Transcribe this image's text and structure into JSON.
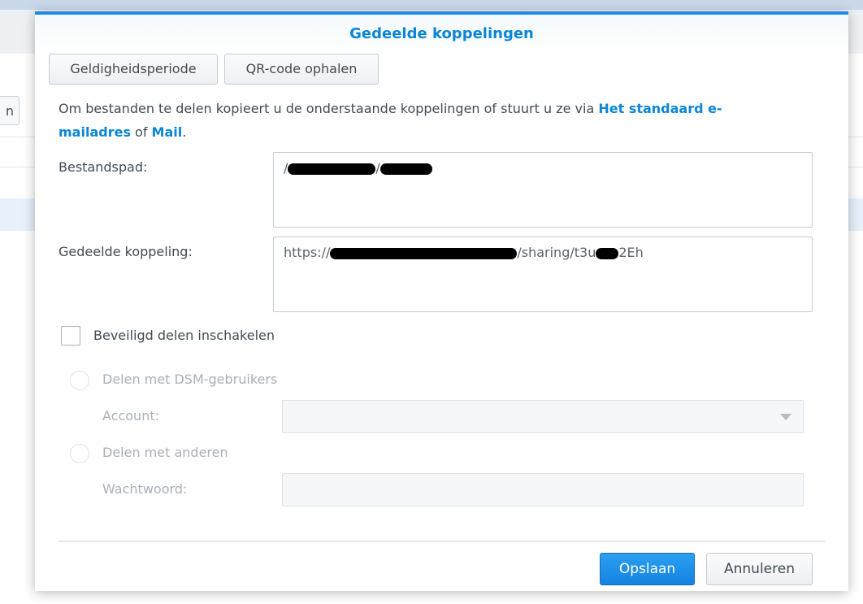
{
  "dialog": {
    "title": "Gedeelde koppelingen",
    "tabs": [
      "Geldigheidsperiode",
      "QR-code ophalen"
    ],
    "description": {
      "before": "Om bestanden te delen kopieert u de onderstaande koppelingen of stuurt u ze via ",
      "link_email": "Het standaard e-mailadres",
      "middle": " of ",
      "link_mail": "Mail",
      "after": "."
    },
    "file_path": {
      "label": "Bestandspad:",
      "value_start": "/",
      "value_sep": "/"
    },
    "shared_link": {
      "label": "Gedeelde koppeling:",
      "value_prefix": "https://",
      "value_middle": "/sharing/t3u",
      "value_suffix": "2Eh"
    },
    "secure_sharing": {
      "checkbox_label": "Beveiligd delen inschakelen",
      "checked": false,
      "option_dsm": "Delen met DSM-gebruikers",
      "account_label": "Account:",
      "account_value": "",
      "option_others": "Delen met anderen",
      "password_label": "Wachtwoord:",
      "password_value": ""
    },
    "buttons": {
      "save": "Opslaan",
      "cancel": "Annuleren"
    }
  },
  "colors": {
    "accent": "#1e8ae5",
    "link": "#0a86d4",
    "primary_button": "#1482e0"
  }
}
